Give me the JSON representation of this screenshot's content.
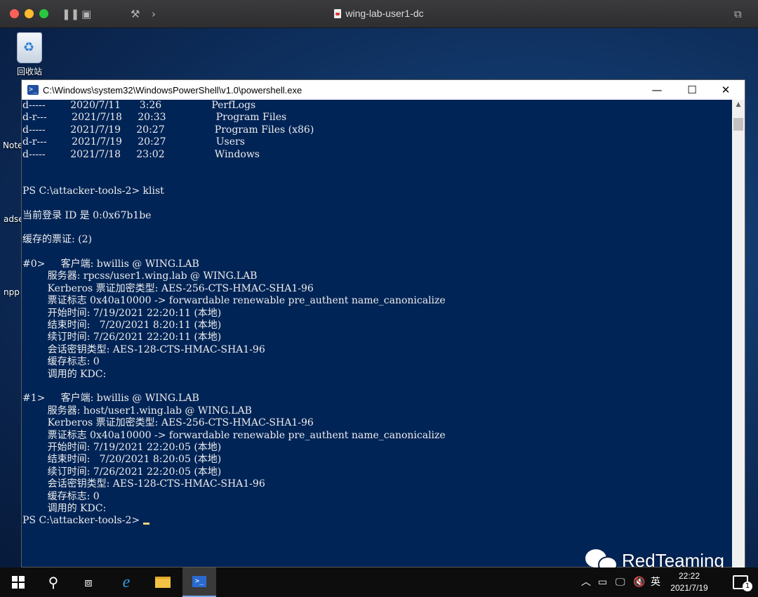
{
  "mac_window": {
    "title": "wing-lab-user1-dc"
  },
  "desktop": {
    "icons": [
      {
        "label": "回收站"
      },
      {
        "label": "Note"
      },
      {
        "label": "adse"
      },
      {
        "label": "npp"
      }
    ]
  },
  "powershell": {
    "title": "C:\\Windows\\system32\\WindowsPowerShell\\v1.0\\powershell.exe",
    "lines": [
      "d-----        2020/7/11      3:26                PerfLogs",
      "d-r---        2021/7/18     20:33                Program Files",
      "d-----        2021/7/19     20:27                Program Files (x86)",
      "d-r---        2021/7/19     20:27                Users",
      "d-----        2021/7/18     23:02                Windows",
      "",
      "",
      "PS C:\\attacker-tools-2> klist",
      "",
      "当前登录 ID 是 0:0x67b1be",
      "",
      "缓存的票证: (2)",
      "",
      "#0>     客户端: bwillis @ WING.LAB",
      "        服务器: rpcss/user1.wing.lab @ WING.LAB",
      "        Kerberos 票证加密类型: AES-256-CTS-HMAC-SHA1-96",
      "        票证标志 0x40a10000 -> forwardable renewable pre_authent name_canonicalize",
      "        开始时间: 7/19/2021 22:20:11 (本地)",
      "        结束时间:   7/20/2021 8:20:11 (本地)",
      "        续订时间: 7/26/2021 22:20:11 (本地)",
      "        会话密钥类型: AES-128-CTS-HMAC-SHA1-96",
      "        缓存标志: 0",
      "        调用的 KDC:",
      "",
      "#1>     客户端: bwillis @ WING.LAB",
      "        服务器: host/user1.wing.lab @ WING.LAB",
      "        Kerberos 票证加密类型: AES-256-CTS-HMAC-SHA1-96",
      "        票证标志 0x40a10000 -> forwardable renewable pre_authent name_canonicalize",
      "        开始时间: 7/19/2021 22:20:05 (本地)",
      "        结束时间:   7/20/2021 8:20:05 (本地)",
      "        续订时间: 7/26/2021 22:20:05 (本地)",
      "        会话密钥类型: AES-128-CTS-HMAC-SHA1-96",
      "        缓存标志: 0",
      "        调用的 KDC:"
    ],
    "prompt": "PS C:\\attacker-tools-2> "
  },
  "taskbar": {
    "ime": "英",
    "time": "22:22",
    "date": "2021/7/19",
    "notification_count": "1"
  },
  "watermark": {
    "text": "RedTeaming"
  }
}
